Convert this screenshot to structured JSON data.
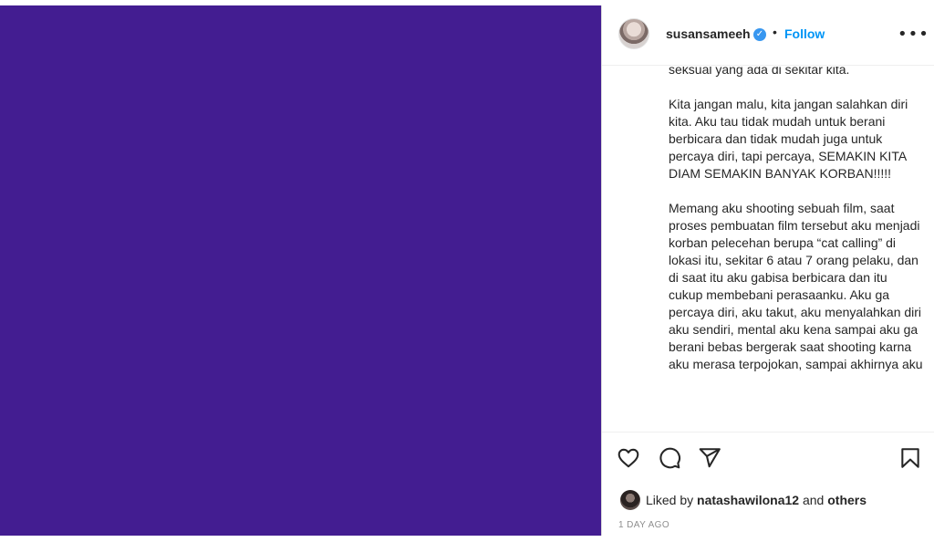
{
  "post": {
    "media_color": "#431d91",
    "author": {
      "username": "susansameeh",
      "verified": true
    },
    "follow_label": "Follow",
    "separator": "•",
    "more_label": "•••",
    "caption": "seksual yang ada di sekitar kita.\n\nKita jangan malu, kita jangan salahkan diri kita. Aku tau tidak mudah untuk berani berbicara dan tidak mudah juga untuk percaya diri, tapi percaya, SEMAKIN KITA DIAM SEMAKIN BANYAK KORBAN!!!!!\n\nMemang aku shooting sebuah film, saat proses pembuatan film tersebut aku menjadi korban pelecehan berupa “cat calling” di lokasi itu, sekitar 6 atau 7 orang pelaku, dan di saat itu aku gabisa berbicara dan itu cukup membebani perasaanku. Aku ga percaya diri, aku takut, aku menyalahkan diri aku sendiri, mental aku kena sampai aku ga berani bebas bergerak saat shooting karna aku merasa terpojokan, sampai akhirnya aku",
    "likes": {
      "prefix": "Liked by",
      "user": "natashawilona12",
      "joiner": "and",
      "suffix": "others"
    },
    "timestamp": "1 DAY AGO",
    "icons": [
      "heart-icon",
      "comment-icon",
      "share-icon",
      "bookmark-icon",
      "more-options-icon",
      "verified-badge-icon"
    ]
  }
}
